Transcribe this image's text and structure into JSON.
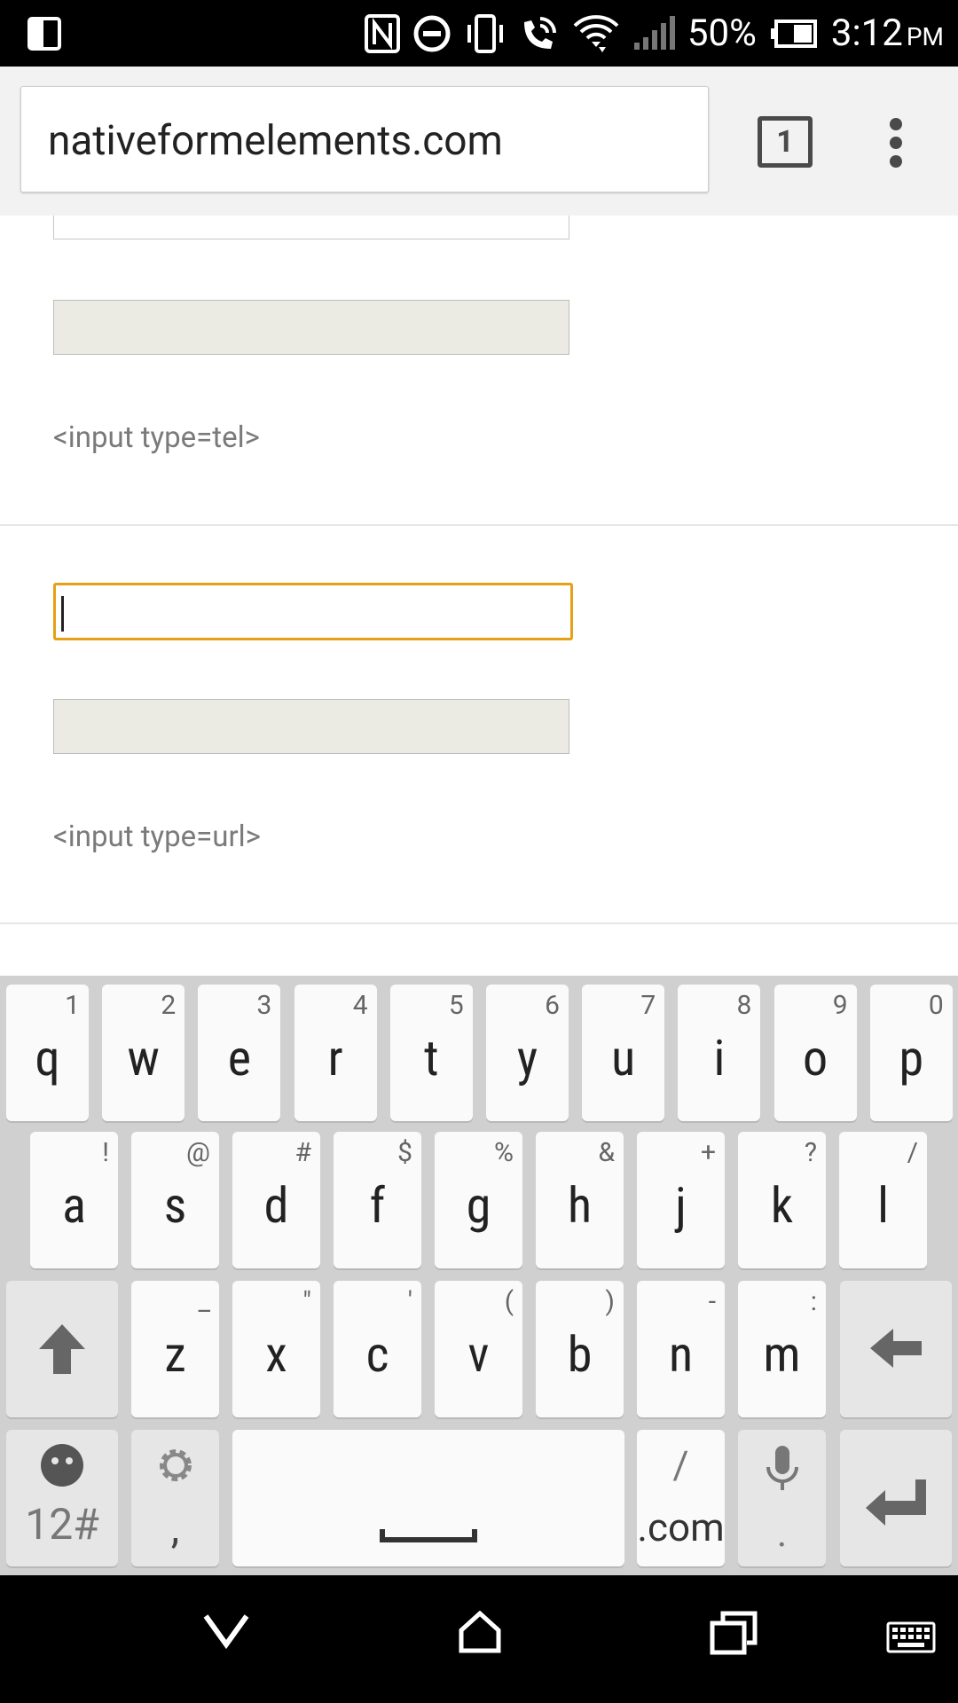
{
  "status_bar": {
    "battery_percent": "50%",
    "time": "3:12",
    "ampm": "PM",
    "icons": [
      "screen-mirror-icon",
      "nfc-icon",
      "do-not-disturb-icon",
      "vibrate-icon",
      "wifi-calling-icon",
      "wifi-icon",
      "cell-signal-icon",
      "battery-icon"
    ]
  },
  "browser": {
    "url": "nativeformelements.com",
    "tab_count": "1"
  },
  "page": {
    "section_tel_label": "<input type=tel>",
    "section_url_label": "<input type=url>"
  },
  "keyboard": {
    "row1": [
      {
        "key": "q",
        "hint": "1"
      },
      {
        "key": "w",
        "hint": "2"
      },
      {
        "key": "e",
        "hint": "3"
      },
      {
        "key": "r",
        "hint": "4"
      },
      {
        "key": "t",
        "hint": "5"
      },
      {
        "key": "y",
        "hint": "6"
      },
      {
        "key": "u",
        "hint": "7"
      },
      {
        "key": "i",
        "hint": "8"
      },
      {
        "key": "o",
        "hint": "9"
      },
      {
        "key": "p",
        "hint": "0"
      }
    ],
    "row2": [
      {
        "key": "a",
        "hint": "!"
      },
      {
        "key": "s",
        "hint": "@"
      },
      {
        "key": "d",
        "hint": "#"
      },
      {
        "key": "f",
        "hint": "$"
      },
      {
        "key": "g",
        "hint": "%"
      },
      {
        "key": "h",
        "hint": "&"
      },
      {
        "key": "j",
        "hint": "+"
      },
      {
        "key": "k",
        "hint": "?"
      },
      {
        "key": "l",
        "hint": "/"
      }
    ],
    "row3": [
      {
        "key": "z",
        "hint": "_"
      },
      {
        "key": "x",
        "hint": "\""
      },
      {
        "key": "c",
        "hint": "'"
      },
      {
        "key": "v",
        "hint": "("
      },
      {
        "key": "b",
        "hint": ")"
      },
      {
        "key": "n",
        "hint": "-"
      },
      {
        "key": "m",
        "hint": ":"
      }
    ],
    "symbols_label": "12#",
    "comma_label": ",",
    "dotcom_label": ".com",
    "slash_label": "/",
    "period_label": "."
  }
}
